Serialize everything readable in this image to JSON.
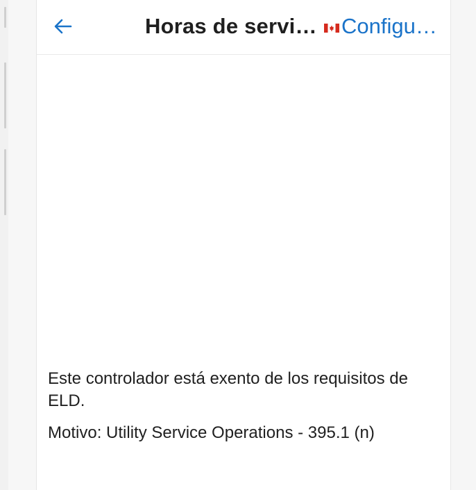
{
  "header": {
    "back_icon": "arrow-left-icon",
    "title": "Horas de servi…",
    "flag_icon": "canada-flag-icon",
    "settings_label": "Configu…"
  },
  "colors": {
    "accent": "#1a73c9",
    "text": "#202020",
    "flag_red": "#d52b1e"
  },
  "body": {
    "exempt_message": "Este controlador está exento de los requisitos de ELD.",
    "reason": "Motivo: Utility Service Operations - 395.1 (n)"
  }
}
